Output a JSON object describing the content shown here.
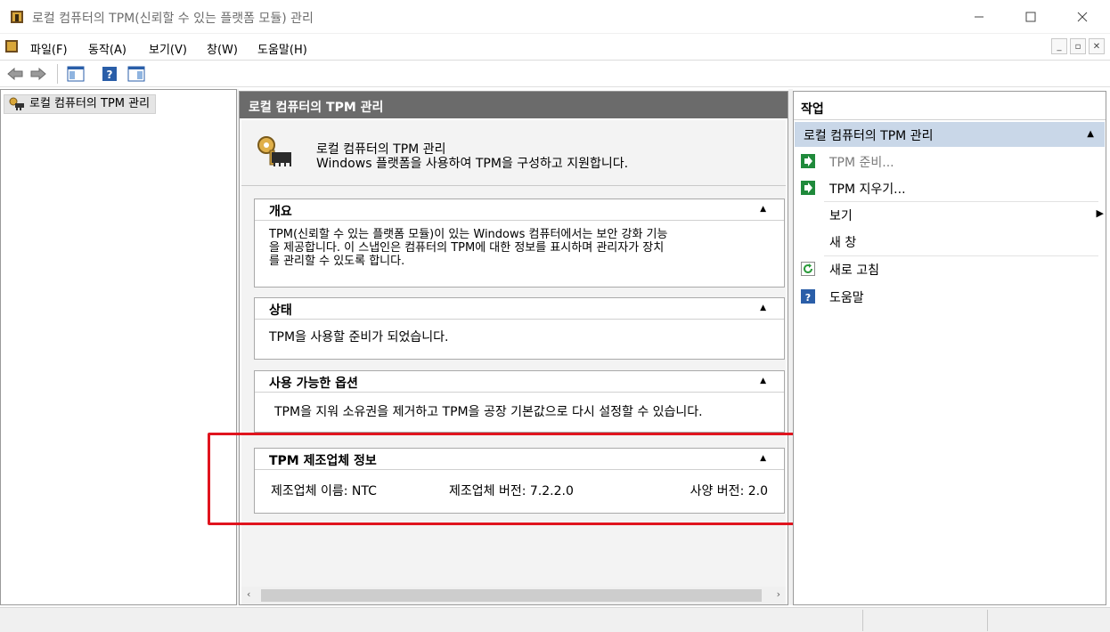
{
  "window": {
    "title": "로컬 컴퓨터의 TPM(신뢰할 수 있는 플랫폼 모듈) 관리"
  },
  "menu": {
    "items": [
      "파일(F)",
      "동작(A)",
      "보기(V)",
      "창(W)",
      "도움말(H)"
    ]
  },
  "tree": {
    "root_label": "로컬 컴퓨터의 TPM 관리"
  },
  "main": {
    "header": "로컬 컴퓨터의 TPM 관리",
    "intro_title": "로컬 컴퓨터의 TPM 관리",
    "intro_desc": "Windows 플랫폼을 사용하여 TPM을 구성하고 지원합니다.",
    "sections": {
      "overview": {
        "title": "개요",
        "lines": [
          "TPM(신뢰할 수 있는 플랫폼 모듈)이 있는 Windows 컴퓨터에서는 보안 강화 기능",
          "을 제공합니다. 이 스냅인은 컴퓨터의 TPM에 대한 정보를 표시하며 관리자가 장치",
          "를 관리할 수 있도록 합니다."
        ]
      },
      "status": {
        "title": "상태",
        "text": "TPM을 사용할 준비가 되었습니다."
      },
      "options": {
        "title": "사용 가능한 옵션",
        "text": "TPM을 지워 소유권을 제거하고 TPM을 공장 기본값으로 다시 설정할 수 있습니다."
      },
      "manufacturer": {
        "title": "TPM 제조업체 정보",
        "name": "제조업체 이름: NTC",
        "version": "제조업체 버전: 7.2.2.0",
        "spec": "사양 버전: 2.0"
      }
    }
  },
  "actions": {
    "title": "작업",
    "group": "로컬 컴퓨터의 TPM 관리",
    "items": {
      "prepare": "TPM 준비...",
      "clear": "TPM 지우기...",
      "view": "보기",
      "new_window": "새 창",
      "refresh": "새로 고침",
      "help": "도움말"
    }
  },
  "colors": {
    "highlight": "#e0141e",
    "header_bg": "#6b6b6b",
    "action_group_bg": "#c9d7e8"
  }
}
